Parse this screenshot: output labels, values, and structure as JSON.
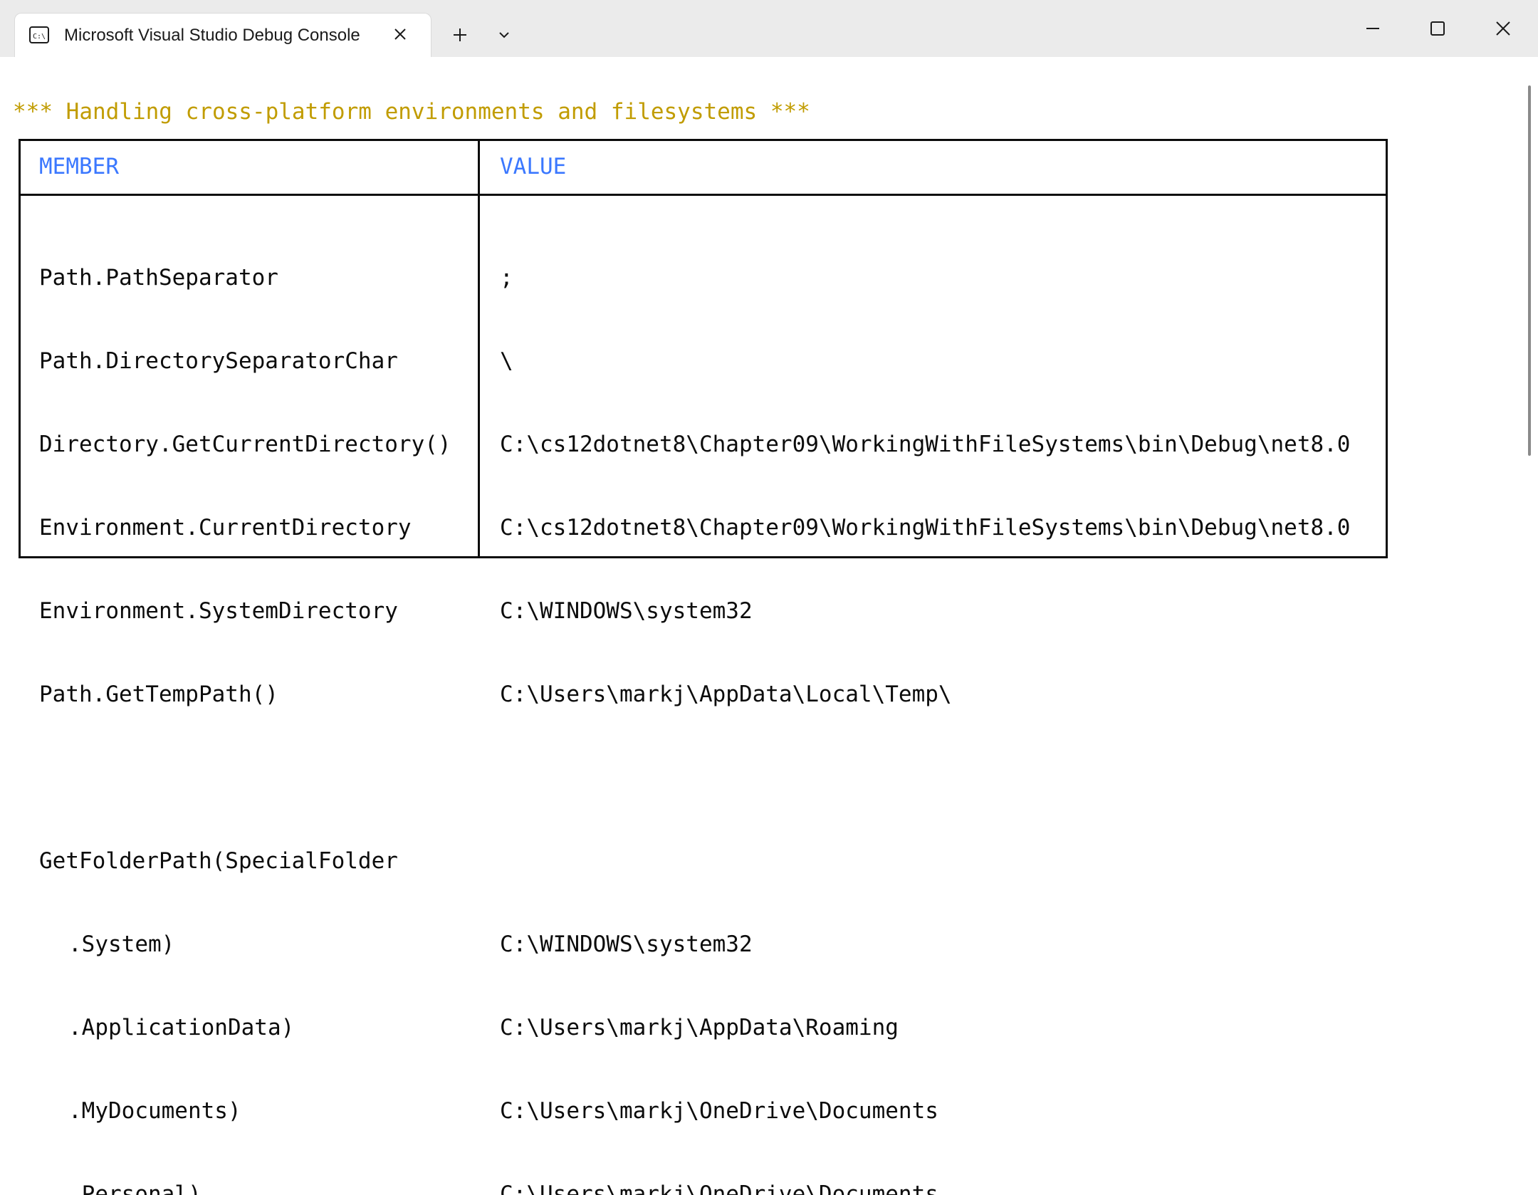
{
  "window": {
    "title": "Microsoft Visual Studio Debug Console",
    "icon": "console-icon",
    "controls": [
      "minimize-icon",
      "maximize-icon",
      "close-icon"
    ]
  },
  "tabs": {
    "new_tab_icon": "plus-icon",
    "dropdown_icon": "chevron-down-icon"
  },
  "console": {
    "heading": "*** Handling cross-platform environments and filesystems ***",
    "heading_color": "#c19c00",
    "header_color": "#3b78ff",
    "table": {
      "header_member": "MEMBER",
      "header_value": "VALUE",
      "rows": [
        {
          "member": "Path.PathSeparator",
          "value": ";"
        },
        {
          "member": "Path.DirectorySeparatorChar",
          "value": "\\"
        },
        {
          "member": "Directory.GetCurrentDirectory()",
          "value": "C:\\cs12dotnet8\\Chapter09\\WorkingWithFileSystems\\bin\\Debug\\net8.0"
        },
        {
          "member": "Environment.CurrentDirectory",
          "value": "C:\\cs12dotnet8\\Chapter09\\WorkingWithFileSystems\\bin\\Debug\\net8.0"
        },
        {
          "member": "Environment.SystemDirectory",
          "value": "C:\\WINDOWS\\system32"
        },
        {
          "member": "Path.GetTempPath()",
          "value": "C:\\Users\\markj\\AppData\\Local\\Temp\\"
        },
        {
          "member": "",
          "value": ""
        },
        {
          "member": "GetFolderPath(SpecialFolder",
          "value": ""
        },
        {
          "member": ".System)",
          "value": "C:\\WINDOWS\\system32"
        },
        {
          "member": ".ApplicationData)",
          "value": "C:\\Users\\markj\\AppData\\Roaming"
        },
        {
          "member": ".MyDocuments)",
          "value": "C:\\Users\\markj\\OneDrive\\Documents"
        },
        {
          "member": ".Personal)",
          "value": "C:\\Users\\markj\\OneDrive\\Documents"
        }
      ]
    }
  }
}
